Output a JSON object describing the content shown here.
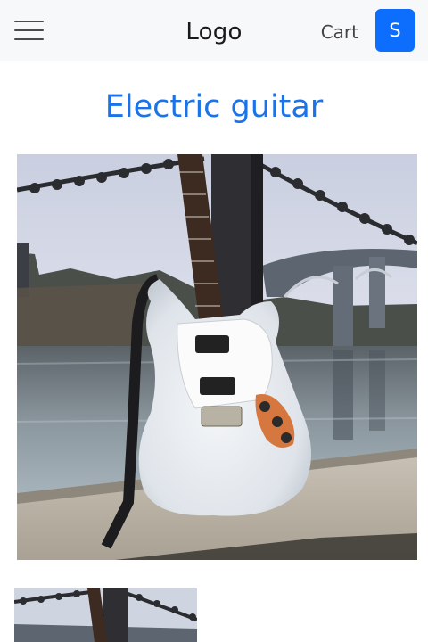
{
  "navbar": {
    "menu_icon": "hamburger-menu-icon",
    "logo": "Logo",
    "cart_label": "Cart",
    "user_initial": "S",
    "accent_color": "#0d6efd"
  },
  "product": {
    "title": "Electric guitar",
    "title_color": "#1a73e8"
  }
}
